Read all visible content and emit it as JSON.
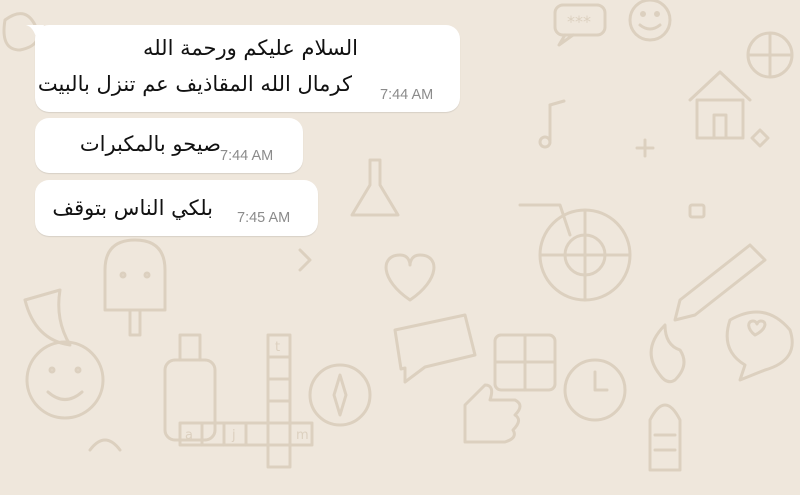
{
  "chat": {
    "messages": [
      {
        "lines": [
          "السلام عليكم ورحمة الله",
          "كرمال الله المقاذيف عم تنزل بالبيت"
        ],
        "time": "7:44 AM"
      },
      {
        "lines": [
          "صيحو بالمكبرات"
        ],
        "time": "7:44 AM"
      },
      {
        "lines": [
          "بلكي الناس بتوقف"
        ],
        "time": "7:45 AM"
      }
    ]
  },
  "theme": {
    "wallpaper_color": "#efe7dc",
    "doodle_color": "#dcd0bf",
    "bubble_color": "#ffffff",
    "text_color": "#111111",
    "time_color": "#8b8b8b"
  },
  "wallpaper": {
    "doodle_text_letters": [
      "t",
      "a",
      "j",
      "m"
    ]
  }
}
